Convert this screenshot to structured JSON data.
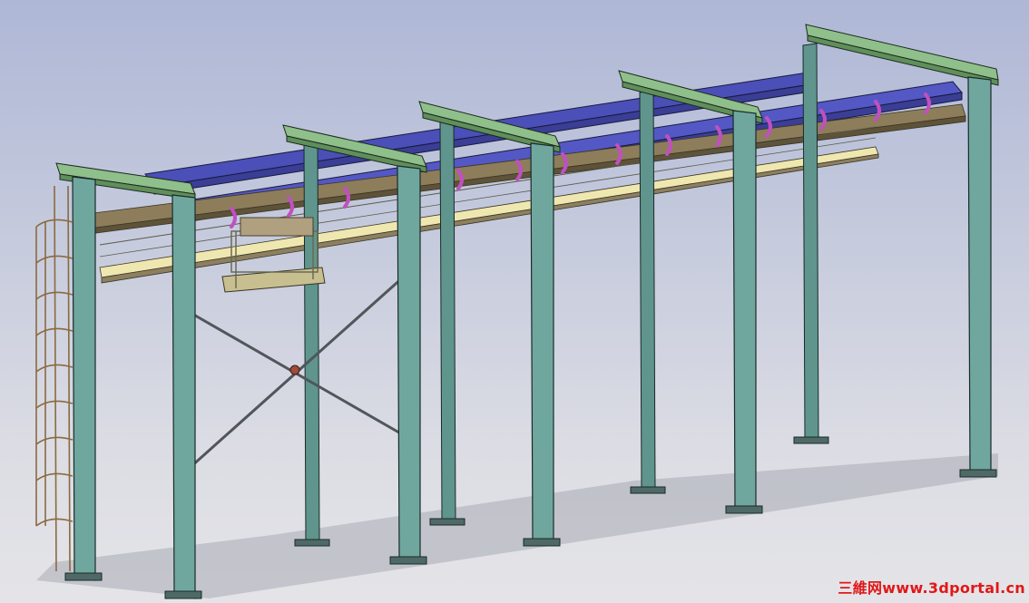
{
  "viewport": {
    "background_top": "#aeb7d6",
    "background_bottom": "#e4e4e8"
  },
  "model": {
    "colors": {
      "column": "#6fa79e",
      "column_shade": "#4f8078",
      "crossbeam": "#8fbf8a",
      "runway_beam": "#4b4fb8",
      "walkway_rail": "#9b8f6a",
      "walkway_deck": "#efe7b0",
      "hanger": "#c050c0",
      "ladder": "#8a6a40"
    },
    "icons": [
      "column",
      "crossbeam",
      "runway-beam",
      "ladder-cage",
      "x-bracing",
      "hoist-carriage"
    ]
  },
  "watermark": {
    "text": "三維网www.3dportal.cn",
    "color": "#e01818"
  }
}
